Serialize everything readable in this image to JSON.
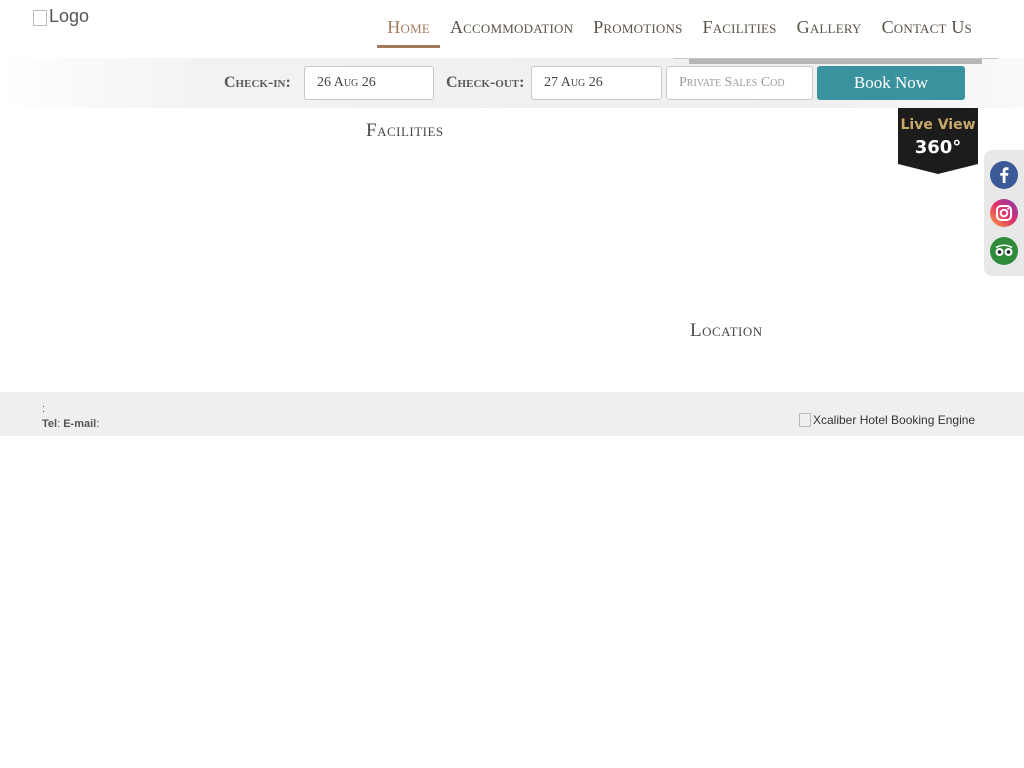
{
  "header": {
    "logo_alt": "Logo",
    "nav": [
      {
        "label": "Home",
        "active": true
      },
      {
        "label": "Accommodation",
        "active": false
      },
      {
        "label": "Promotions",
        "active": false
      },
      {
        "label": "Facilities",
        "active": false
      },
      {
        "label": "Gallery",
        "active": false
      },
      {
        "label": "Contact Us",
        "active": false
      }
    ]
  },
  "booking": {
    "checkin_label": "Check-in:",
    "checkin_value": "26 Aug 26",
    "checkout_label": "Check-out:",
    "checkout_value": "27 Aug 26",
    "promo_placeholder": "Private Sales Cod",
    "book_label": "Book Now",
    "book_color": "#3a929f"
  },
  "sections": {
    "facilities_title": "Facilities",
    "location_title": "Location"
  },
  "live_view": {
    "line1": "Live View",
    "line2": "360°"
  },
  "social": [
    {
      "name": "facebook-icon",
      "color": "#3b5998"
    },
    {
      "name": "instagram-icon",
      "color": "#c13584"
    },
    {
      "name": "tripadvisor-icon",
      "color": "#2e8b3a"
    }
  ],
  "footer": {
    "colon": ":",
    "tel_label": "Tel",
    "email_label": "E-mail",
    "engine_alt": "Xcaliber Hotel Booking Engine"
  },
  "colors": {
    "accent": "#a47a5e",
    "footer_bg": "#efefef"
  }
}
